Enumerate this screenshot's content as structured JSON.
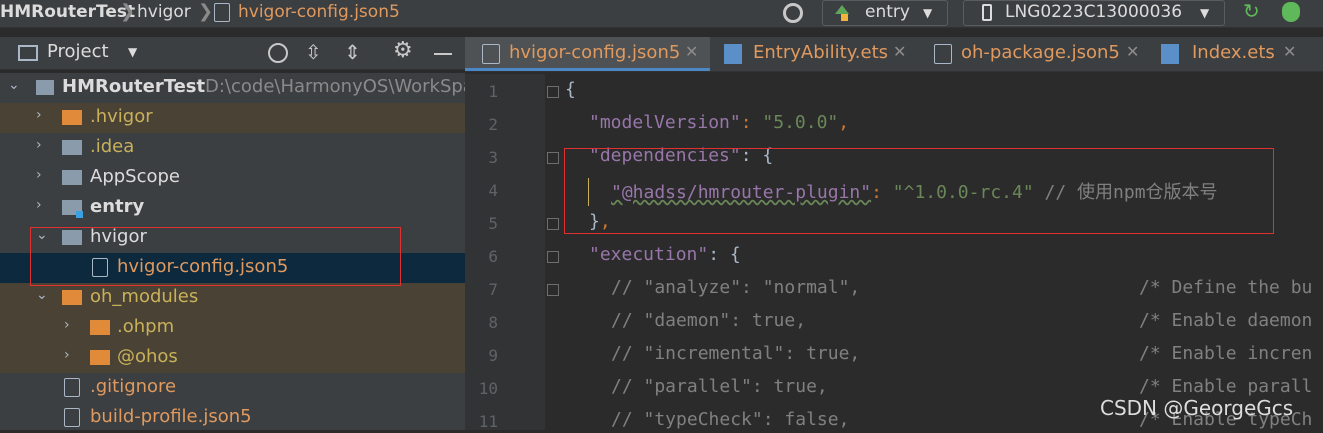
{
  "breadcrumb": {
    "project": "HMRouterTest",
    "folder": "hvigor",
    "file": "hvigor-config.json5"
  },
  "toolbar": {
    "run_config": "entry",
    "device": "LNG0223C13000036"
  },
  "project_panel": {
    "title": "Project",
    "root": {
      "name": "HMRouterTest",
      "path": "D:\\code\\HarmonyOS\\WorkSpa"
    },
    "items": [
      {
        "label": ".hvigor"
      },
      {
        "label": ".idea"
      },
      {
        "label": "AppScope"
      },
      {
        "label": "entry"
      },
      {
        "label": "hvigor"
      },
      {
        "label": "hvigor-config.json5"
      },
      {
        "label": "oh_modules"
      },
      {
        "label": ".ohpm"
      },
      {
        "label": "@ohos"
      },
      {
        "label": ".gitignore"
      },
      {
        "label": "build-profile.json5"
      }
    ]
  },
  "editor": {
    "tabs": [
      {
        "label": "hvigor-config.json5"
      },
      {
        "label": "EntryAbility.ets"
      },
      {
        "label": "oh-package.json5"
      },
      {
        "label": "Index.ets"
      }
    ],
    "line_numbers": [
      "1",
      "2",
      "3",
      "4",
      "5",
      "6",
      "7",
      "8",
      "9",
      "10",
      "11"
    ],
    "lines": {
      "l1_brace": "{",
      "l2_key": "\"modelVersion\"",
      "l2_colon": ": ",
      "l2_val": "\"5.0.0\"",
      "l2_comma": ",",
      "l3_key": "\"dependencies\"",
      "l3_rest": ": {",
      "l4_key": "\"@hadss/hmrouter-plugin\"",
      "l4_colon": ": ",
      "l4_val": "\"^1.0.0-rc.4\"",
      "l4_comment": " // 使用npm仓版本号",
      "l5_brace": "}",
      "l5_comma": ",",
      "l6_key": "\"execution\"",
      "l6_rest": ": {",
      "l7_code": "// \"analyze\": \"normal\",",
      "l7_comment": "/* Define the bu",
      "l8_code": "// \"daemon\": true,",
      "l8_comment": "/* Enable daemon",
      "l9_code": "// \"incremental\": true,",
      "l9_comment": "/* Enable incren",
      "l10_code": "// \"parallel\": true,",
      "l10_comment": "/* Enable parall",
      "l11_code": "// \"typeCheck\": false,",
      "l11_comment": "/* Enable typeCh"
    }
  },
  "watermark": "CSDN @GeorgeGcs",
  "colors": {
    "highlight_box": "#e03030",
    "modified_file": "#e0995e",
    "ignored_folder": "#c9b15a"
  }
}
